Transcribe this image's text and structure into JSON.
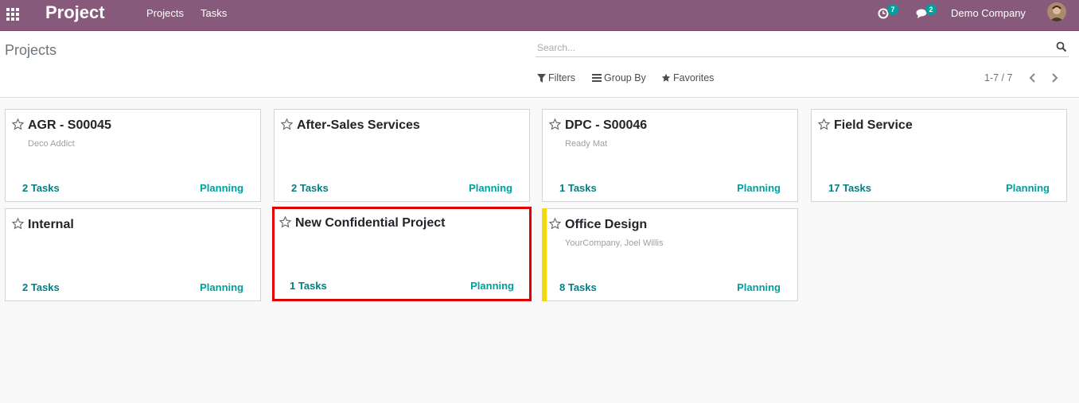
{
  "navbar": {
    "app_name": "Project",
    "menu": [
      "Projects",
      "Tasks"
    ],
    "activity_count": "7",
    "messages_count": "2",
    "company": "Demo Company"
  },
  "control_panel": {
    "title": "Projects",
    "search_placeholder": "Search...",
    "filters_label": "Filters",
    "group_by_label": "Group By",
    "favorites_label": "Favorites",
    "pager": "1-7 / 7"
  },
  "colors": {
    "navbar": "#875a7b",
    "accent": "#00a09d",
    "highlight": "#e00000",
    "color_tag": "#f3d80a"
  },
  "projects": [
    {
      "name": "AGR - S00045",
      "customer": "Deco Addict",
      "tasks": "2 Tasks",
      "stage": "Planning"
    },
    {
      "name": "After-Sales Services",
      "customer": "",
      "tasks": "2 Tasks",
      "stage": "Planning"
    },
    {
      "name": "DPC - S00046",
      "customer": "Ready Mat",
      "tasks": "1 Tasks",
      "stage": "Planning"
    },
    {
      "name": "Field Service",
      "customer": "",
      "tasks": "17 Tasks",
      "stage": "Planning"
    },
    {
      "name": "Internal",
      "customer": "",
      "tasks": "2 Tasks",
      "stage": "Planning"
    },
    {
      "name": "New Confidential Project",
      "customer": "",
      "tasks": "1 Tasks",
      "stage": "Planning"
    },
    {
      "name": "Office Design",
      "customer": "YourCompany, Joel Willis",
      "tasks": "8 Tasks",
      "stage": "Planning"
    }
  ]
}
